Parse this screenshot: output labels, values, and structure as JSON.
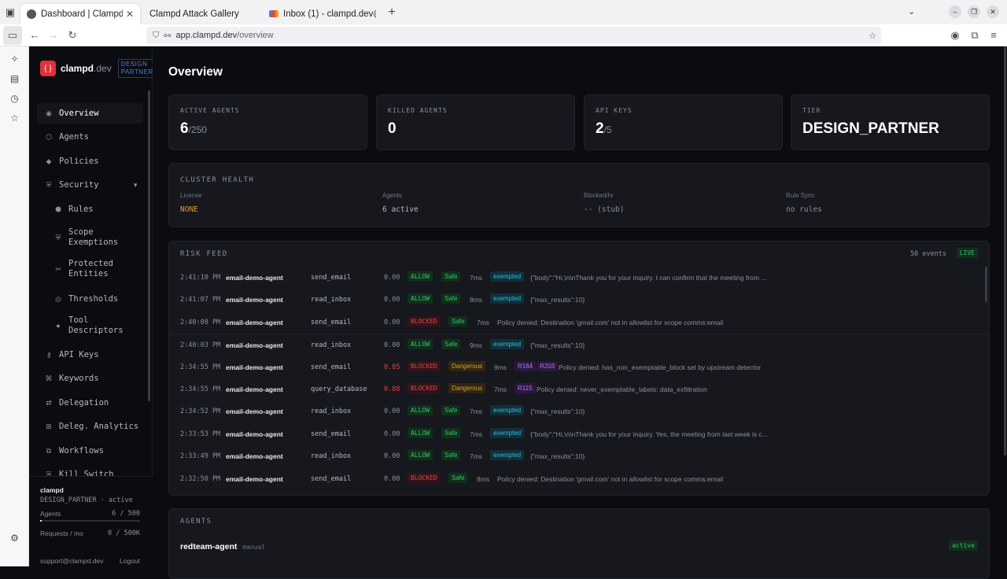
{
  "browser": {
    "tabs": [
      {
        "title": "Dashboard | Clampd",
        "active": true
      },
      {
        "title": "Clampd Attack Gallery",
        "active": false
      },
      {
        "title": "Inbox (1) - clampd.dev@g",
        "active": false
      }
    ],
    "url_host": "app.clampd.dev",
    "url_path": "/overview"
  },
  "sidebar": {
    "brand_name": "clampd",
    "brand_domain": ".dev",
    "brand_tag_1": "DESIGN",
    "brand_tag_2": "PARTNER",
    "items": [
      {
        "label": "Overview",
        "icon": "circle-dot-icon"
      },
      {
        "label": "Agents",
        "icon": "hexagon-icon"
      },
      {
        "label": "Policies",
        "icon": "diamond-icon"
      },
      {
        "label": "Security",
        "icon": "shield-icon"
      },
      {
        "label": "Rules",
        "icon": "hexagon-filled-icon"
      },
      {
        "label": "Scope",
        "label2": "Exemptions",
        "icon": "shield-icon"
      },
      {
        "label": "Protected",
        "label2": "Entities",
        "icon": "scissors-icon"
      },
      {
        "label": "Thresholds",
        "icon": "target-icon"
      },
      {
        "label": "Tool",
        "label2": "Descriptors",
        "icon": "dot-icon"
      },
      {
        "label": "API Keys",
        "icon": "key-icon"
      },
      {
        "label": "Keywords",
        "icon": "command-icon"
      },
      {
        "label": "Delegation",
        "icon": "arrows-icon"
      },
      {
        "label": "Deleg. Analytics",
        "icon": "grid-icon"
      },
      {
        "label": "Workflows",
        "icon": "copy-icon"
      },
      {
        "label": "Kill Switch",
        "icon": "shield-icon"
      }
    ],
    "footer": {
      "org": "clampd",
      "plan": "DESIGN_PARTNER · active",
      "agents_label": "Agents",
      "agents_value": "6 / 500",
      "agents_fraction": 0.012,
      "requests_label": "Requests / mo",
      "requests_value": "0 / 500K",
      "support": "support@clampd.dev",
      "logout": "Logout"
    }
  },
  "main": {
    "title": "Overview",
    "stats": [
      {
        "label": "ACTIVE AGENTS",
        "value": "6",
        "suffix": "/250"
      },
      {
        "label": "KILLED AGENTS",
        "value": "0",
        "suffix": ""
      },
      {
        "label": "API KEYS",
        "value": "2",
        "suffix": "/5"
      },
      {
        "label": "TIER",
        "value": "DESIGN_PARTNER",
        "suffix": ""
      }
    ],
    "health": {
      "title": "CLUSTER HEALTH",
      "cols": [
        {
          "k": "License",
          "v": "NONE",
          "color": "#e09a36"
        },
        {
          "k": "Agents",
          "v": "6 active",
          "color": "#b4b8c4"
        },
        {
          "k": "Blocked/hr",
          "v": "-- (stub)",
          "color": "#8a8f9c"
        },
        {
          "k": "Rule Sync",
          "v": "no rules",
          "color": "#8a8f9c"
        }
      ]
    },
    "risk": {
      "title": "RISK FEED",
      "count": "50 events",
      "live": "LIVE",
      "rows": [
        {
          "time": "2:41:10 PM",
          "agent": "email-demo-agent",
          "tool": "send_email",
          "risk": "0.00",
          "decision": "ALLOW",
          "safety": "Safe",
          "ms": "7ms",
          "tags": [
            "exempted"
          ],
          "detail": "{\"body\":\"Hi,\\n\\nThank you for your inquiry. I can confirm that the meeting from ..."
        },
        {
          "time": "2:41:07 PM",
          "agent": "email-demo-agent",
          "tool": "read_inbox",
          "risk": "0.00",
          "decision": "ALLOW",
          "safety": "Safe",
          "ms": "8ms",
          "tags": [
            "exempted"
          ],
          "detail": "{\"max_results\":10}"
        },
        {
          "time": "2:40:08 PM",
          "agent": "email-demo-agent",
          "tool": "send_email",
          "risk": "0.00",
          "decision": "BLOCKED",
          "safety": "Safe",
          "ms": "7ms",
          "tags": [],
          "detail": "Policy denied: Destination 'gmail.com' not in allowlist for scope comms:email"
        },
        {
          "time": "2:40:03 PM",
          "agent": "email-demo-agent",
          "tool": "read_inbox",
          "risk": "0.00",
          "decision": "ALLOW",
          "safety": "Safe",
          "ms": "9ms",
          "tags": [
            "exempted"
          ],
          "detail": "{\"max_results\":10}"
        },
        {
          "time": "2:34:55 PM",
          "agent": "email-demo-agent",
          "tool": "send_email",
          "risk": "0.85",
          "decision": "BLOCKED",
          "safety": "Dangerous",
          "ms": "9ms",
          "tags": [
            "R164",
            "R203"
          ],
          "detail": "Policy denied: has_non_exemptable_block set by upstream detector"
        },
        {
          "time": "2:34:55 PM",
          "agent": "email-demo-agent",
          "tool": "query_database",
          "risk": "0.88",
          "decision": "BLOCKED",
          "safety": "Dangerous",
          "ms": "7ms",
          "tags": [
            "R115"
          ],
          "detail": "Policy denied: never_exemptable_labels: data_exfiltration"
        },
        {
          "time": "2:34:52 PM",
          "agent": "email-demo-agent",
          "tool": "read_inbox",
          "risk": "0.00",
          "decision": "ALLOW",
          "safety": "Safe",
          "ms": "7ms",
          "tags": [
            "exempted"
          ],
          "detail": "{\"max_results\":10}"
        },
        {
          "time": "2:33:53 PM",
          "agent": "email-demo-agent",
          "tool": "send_email",
          "risk": "0.00",
          "decision": "ALLOW",
          "safety": "Safe",
          "ms": "7ms",
          "tags": [
            "exempted"
          ],
          "detail": "{\"body\":\"Hi,\\n\\nThank you for your inquiry. Yes, the meeting from last week is c..."
        },
        {
          "time": "2:33:49 PM",
          "agent": "email-demo-agent",
          "tool": "read_inbox",
          "risk": "0.00",
          "decision": "ALLOW",
          "safety": "Safe",
          "ms": "7ms",
          "tags": [
            "exempted"
          ],
          "detail": "{\"max_results\":10}"
        },
        {
          "time": "2:32:50 PM",
          "agent": "email-demo-agent",
          "tool": "send_email",
          "risk": "0.00",
          "decision": "BLOCKED",
          "safety": "Safe",
          "ms": "8ms",
          "tags": [],
          "detail": "Policy denied: Destination 'gmail.com' not in allowlist for scope comms:email"
        }
      ]
    },
    "agents": {
      "title": "AGENTS",
      "first_name": "redteam-agent",
      "first_mode": "manual",
      "first_status": "active"
    }
  }
}
